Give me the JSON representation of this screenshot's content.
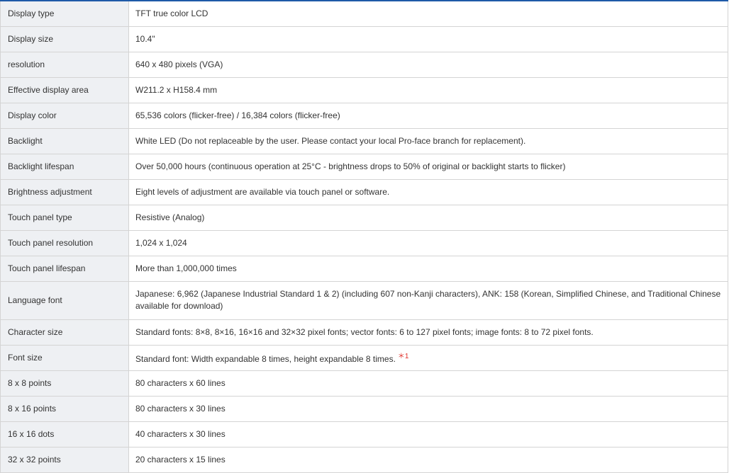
{
  "spec_table": {
    "rows": [
      {
        "label": "Display type",
        "value": "TFT true color LCD"
      },
      {
        "label": "Display size",
        "value": "10.4\""
      },
      {
        "label": "resolution",
        "value": "640 x 480 pixels (VGA)"
      },
      {
        "label": "Effective display area",
        "value": "W211.2 x H158.4 mm"
      },
      {
        "label": "Display color",
        "value": "65,536 colors (flicker-free) / 16,384 colors (flicker-free)"
      },
      {
        "label": "Backlight",
        "value": "White LED (Do not replaceable by the user. Please contact your local Pro-face branch for replacement)."
      },
      {
        "label": "Backlight lifespan",
        "value": "Over 50,000 hours (continuous operation at 25°C - brightness drops to 50% of original or backlight starts to flicker)"
      },
      {
        "label": "Brightness adjustment",
        "value": "Eight levels of adjustment are available via touch panel or software."
      },
      {
        "label": "Touch panel type",
        "value": "Resistive (Analog)"
      },
      {
        "label": "Touch panel resolution",
        "value": "1,024 x 1,024"
      },
      {
        "label": "Touch panel lifespan",
        "value": "More than 1,000,000 times"
      },
      {
        "label": "Language font",
        "value": "Japanese: 6,962 (Japanese Industrial Standard 1 & 2) (including 607 non-Kanji characters), ANK: 158 (Korean, Simplified Chinese, and Traditional Chinese available for download)"
      },
      {
        "label": "Character size",
        "value": "Standard fonts: 8×8, 8×16, 16×16 and 32×32 pixel fonts; vector fonts: 6 to 127 pixel fonts; image fonts: 8 to 72 pixel fonts."
      },
      {
        "label": "Font size",
        "value": "Standard font: Width expandable 8 times, height expandable 8 times.",
        "note": "＊1"
      },
      {
        "label": "8 x 8 points",
        "value": "80 characters x 60 lines"
      },
      {
        "label": "8 x 16 points",
        "value": "80 characters x 30 lines"
      },
      {
        "label": "16 x 16 dots",
        "value": "40 characters x 30 lines"
      },
      {
        "label": "32 x 32 points",
        "value": "20 characters x 15 lines"
      }
    ]
  },
  "colors": {
    "top_border": "#1e5aa8",
    "label_background": "#eef0f3",
    "grid": "#d4d4d4",
    "note": "#e0302a"
  }
}
